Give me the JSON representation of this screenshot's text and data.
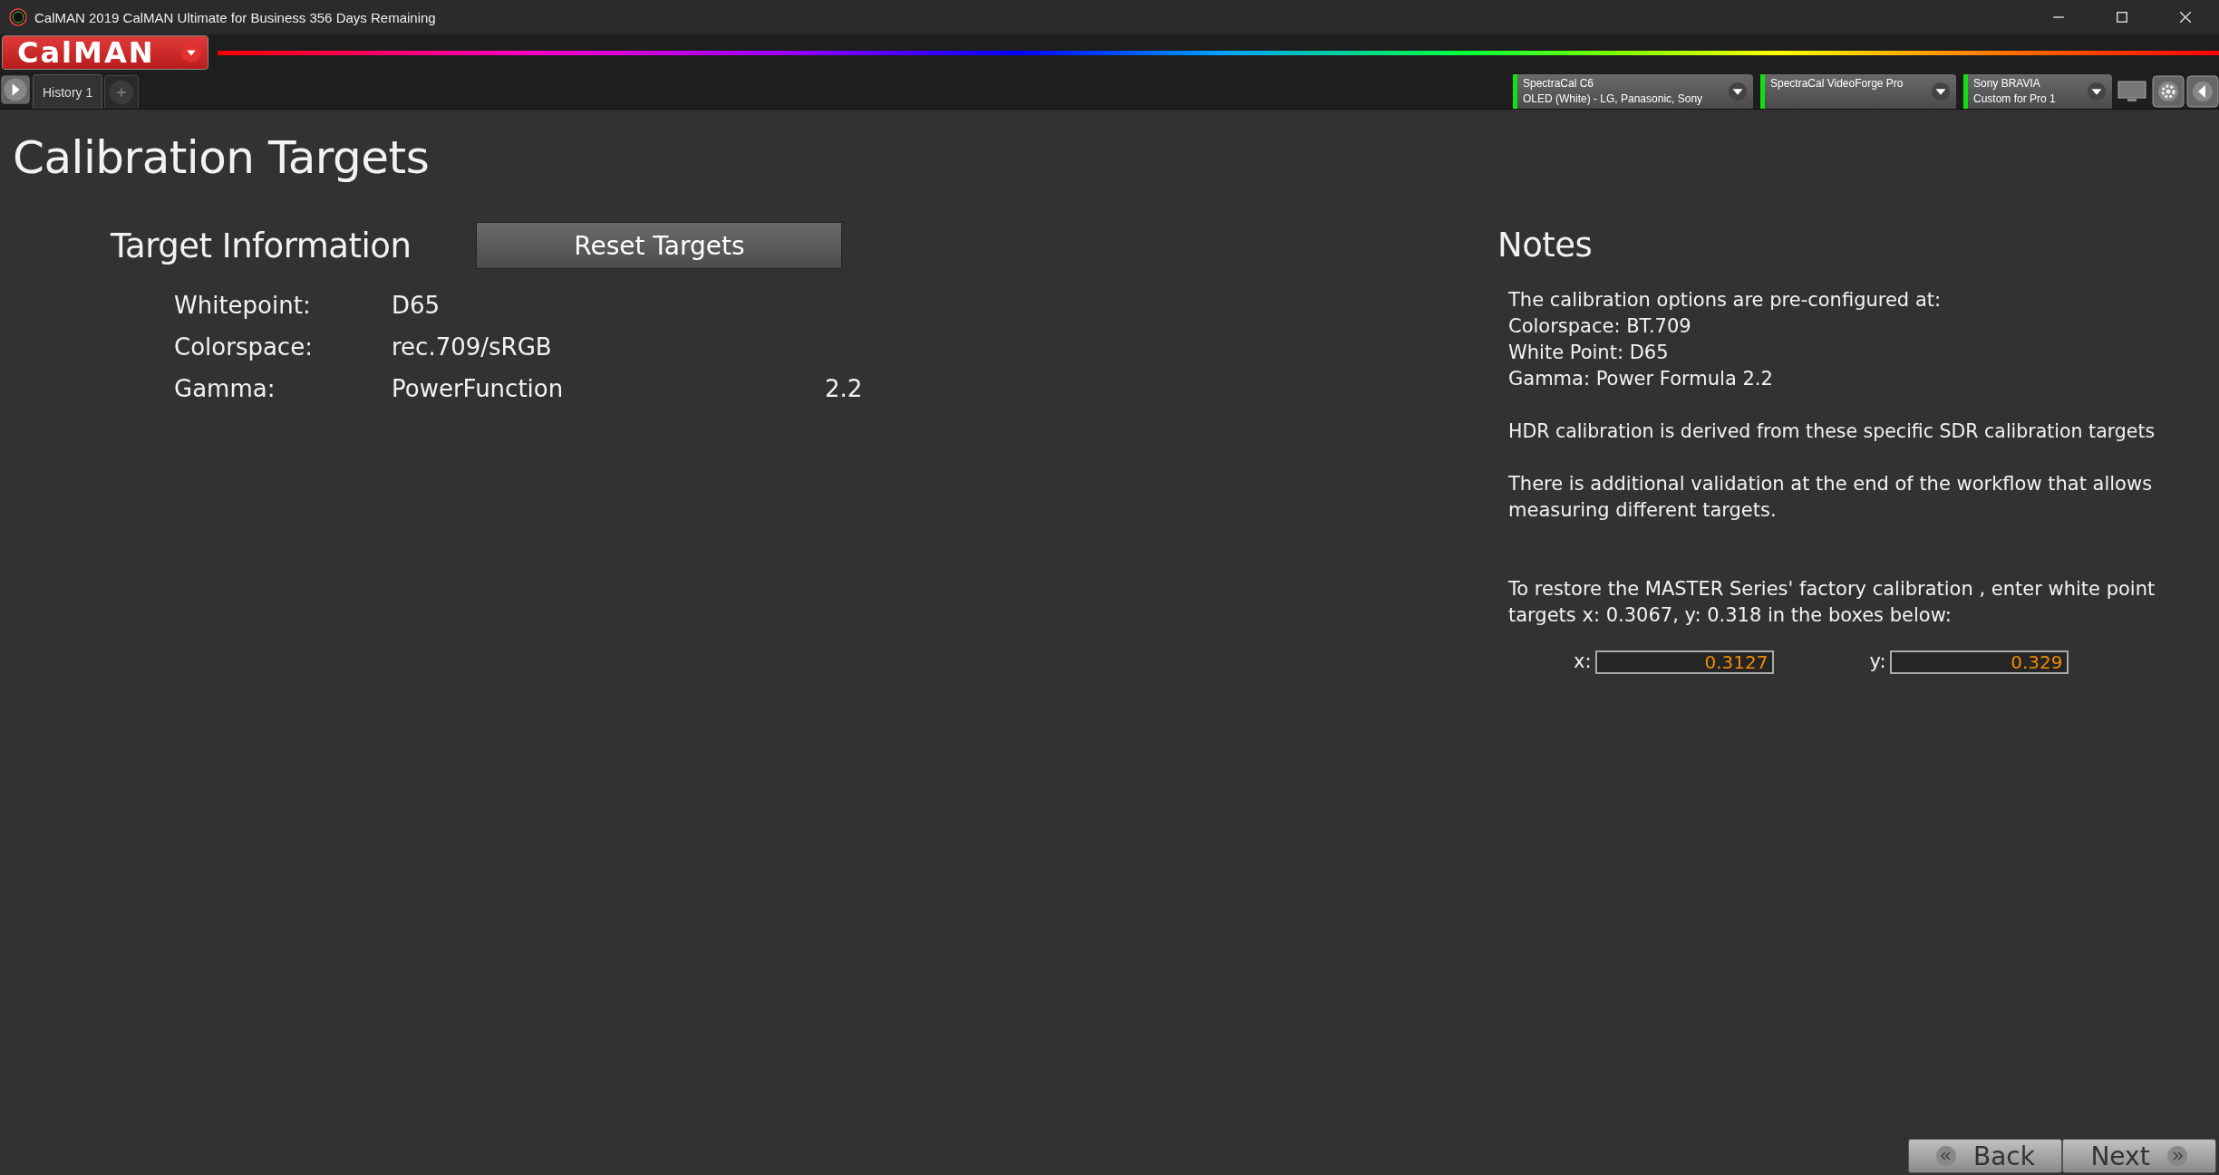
{
  "window": {
    "title": "CalMAN 2019 CalMAN Ultimate for Business 356 Days Remaining"
  },
  "logo": {
    "text": "CalMAN"
  },
  "tabs": [
    {
      "label": "History 1",
      "selected": true
    }
  ],
  "devices": [
    {
      "line1": "SpectraCal C6",
      "line2": "OLED (White) - LG, Panasonic, Sony",
      "connected": true
    },
    {
      "line1": "SpectraCal VideoForge Pro",
      "connected": true
    },
    {
      "line1": "Sony BRAVIA",
      "line2": "Custom for Pro 1",
      "connected": true
    }
  ],
  "page_title": "Calibration Targets",
  "target_info": {
    "heading": "Target Information",
    "reset_button": "Reset Targets",
    "rows": [
      {
        "label": "Whitepoint:",
        "value": "D65"
      },
      {
        "label": "Colorspace:",
        "value": "rec.709/sRGB"
      },
      {
        "label": "Gamma:",
        "value": "PowerFunction",
        "extra": "2.2"
      }
    ]
  },
  "notes": {
    "heading": "Notes",
    "lines": [
      "The calibration options are pre-configured at:",
      "Colorspace: BT.709",
      "White Point: D65",
      "Gamma: Power Formula 2.2"
    ],
    "paragraphs": [
      "HDR calibration is derived from these specific SDR calibration targets",
      "There is additional validation at the end of the workflow that allows measuring different targets."
    ],
    "restore_text": "To restore the MASTER Series' factory calibration , enter white point targets x: 0.3067, y: 0.318 in the boxes below:",
    "fields": [
      {
        "label": "x:",
        "value": "0.3127"
      },
      {
        "label": "y:",
        "value": "0.329"
      }
    ]
  },
  "nav": {
    "back": "Back",
    "next": "Next"
  }
}
